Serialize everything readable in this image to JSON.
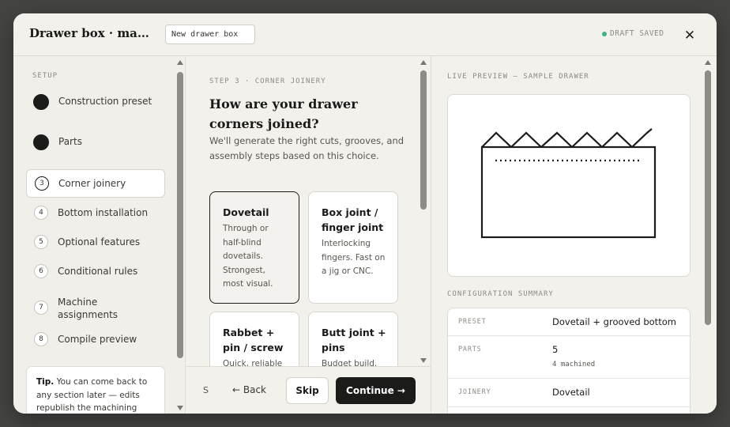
{
  "header": {
    "title": "Drawer box · ma…",
    "name_value": "New drawer box",
    "draft_status": "DRAFT SAVED",
    "close_glyph": "✕"
  },
  "sidebar": {
    "heading": "SETUP",
    "steps": [
      {
        "num": "",
        "label": "Construction preset",
        "state": "done"
      },
      {
        "num": "",
        "label": "Parts",
        "state": "done"
      },
      {
        "num": "3",
        "label": "Corner joinery",
        "state": "active"
      },
      {
        "num": "4",
        "label": "Bottom installation",
        "state": "todo"
      },
      {
        "num": "5",
        "label": "Optional features",
        "state": "todo"
      },
      {
        "num": "6",
        "label": "Conditional rules",
        "state": "todo"
      },
      {
        "num": "7",
        "label": "Machine assignments",
        "state": "todo"
      },
      {
        "num": "8",
        "label": "Compile preview",
        "state": "todo"
      }
    ],
    "tip_label": "Tip.",
    "tip_text": " You can come back to any section later — edits republish the machining plan for any new orders."
  },
  "main": {
    "step_label": "STEP 3 · CORNER JOINERY",
    "question": "How are your drawer corners joined?",
    "subtitle": "We'll generate the right cuts, grooves, and assembly steps based on this choice.",
    "options": [
      {
        "title": "Dovetail",
        "desc": "Through or half-blind dovetails. Strongest, most visual.",
        "selected": true
      },
      {
        "title": "Box joint / finger joint",
        "desc": "Interlocking fingers. Fast on a jig or CNC.",
        "selected": false
      },
      {
        "title": "Rabbet + pin / screw",
        "desc": "Quick, reliable",
        "selected": false
      },
      {
        "title": "Butt joint + pins",
        "desc": "Budget build.",
        "selected": false
      }
    ]
  },
  "footer": {
    "shortcut": "S",
    "back_label": "← Back",
    "skip_label": "Skip",
    "continue_label": "Continue →"
  },
  "preview": {
    "heading": "LIVE PREVIEW — SAMPLE DRAWER",
    "summary_heading": "CONFIGURATION SUMMARY",
    "summary": [
      {
        "key": "PRESET",
        "value": "Dovetail + grooved bottom",
        "sub": ""
      },
      {
        "key": "PARTS",
        "value": "5",
        "sub": "4 machined"
      },
      {
        "key": "JOINERY",
        "value": "Dovetail",
        "sub": ""
      }
    ]
  },
  "colors": {
    "accent": "#1b1b19",
    "status_ok": "#3fb27f",
    "surface": "#f3f1ec"
  }
}
